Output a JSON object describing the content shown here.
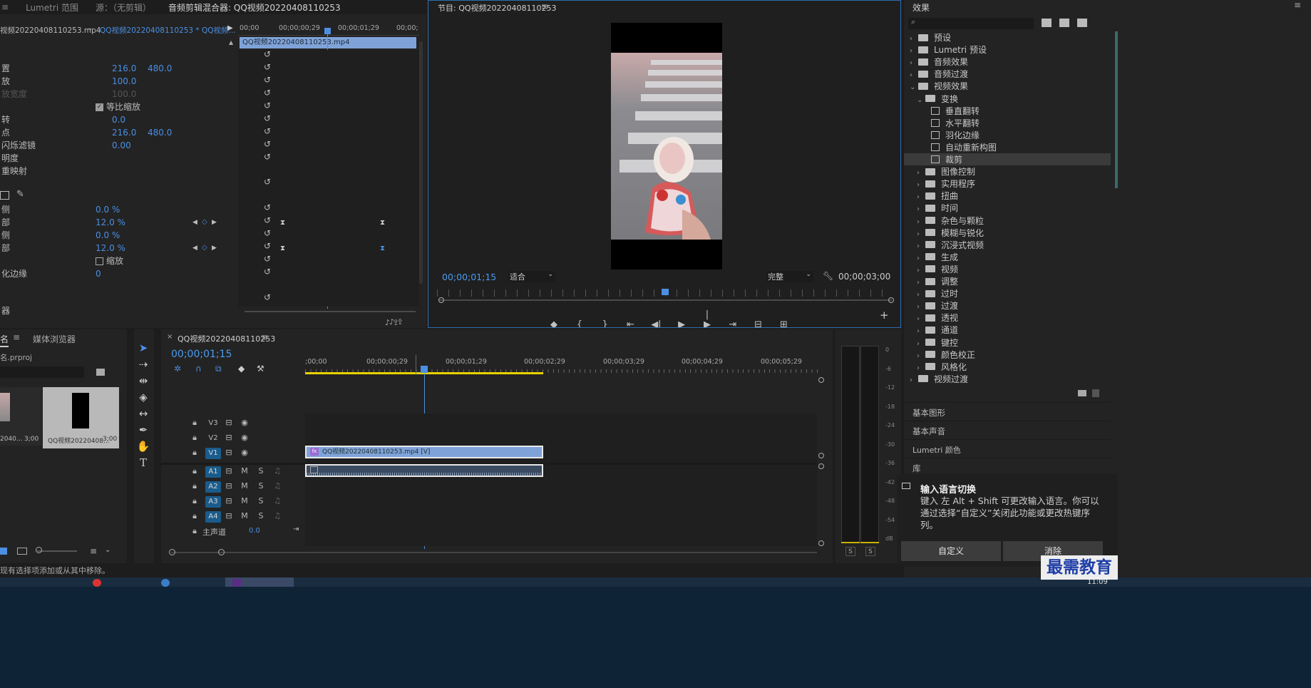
{
  "top_tabs": {
    "tab1": "Lumetri 范围",
    "tab2": "源：（无剪辑）",
    "tab3": "音频剪辑混合器: QQ视频20220408110253",
    "menu": "≡"
  },
  "effect_controls": {
    "clip_source": "视频20220408110253.mp4",
    "clip_seq": "QQ视频20220408110253 * QQ视频...",
    "ruler": [
      "00;00",
      "00;00;00;29",
      "00;00;01;29",
      "00;00;"
    ],
    "clip_bar": "QQ视频20220408110253.mp4",
    "rows": [
      {
        "label": "置",
        "v1": "216.0",
        "v2": "480.0"
      },
      {
        "label": "放",
        "v1": "100.0",
        "v2": ""
      },
      {
        "label": "放宽度",
        "v1": "100.0",
        "v2": ""
      },
      {
        "label": "",
        "v1": "",
        "v2": ""
      },
      {
        "label": "转",
        "v1": "0.0",
        "v2": ""
      },
      {
        "label": "点",
        "v1": "216.0",
        "v2": "480.0"
      },
      {
        "label": "闪烁滤镜",
        "v1": "0.00",
        "v2": ""
      },
      {
        "label": "明度",
        "v1": "",
        "v2": ""
      },
      {
        "label": "重映射",
        "v1": "",
        "v2": ""
      }
    ],
    "uniform_scale": "等比缩放",
    "crop_rows": [
      {
        "label": "侧",
        "v1": "0.0 %"
      },
      {
        "label": "部",
        "v1": "12.0 %"
      },
      {
        "label": "侧",
        "v1": "0.0 %"
      },
      {
        "label": "部",
        "v1": "12.0 %"
      }
    ],
    "zoom_label": "缩放",
    "feather_label": "化边缘",
    "feather_value": "0",
    "bottom_label": "器"
  },
  "program": {
    "title": "节目: QQ视频20220408110253",
    "timecode": "00;00;01;15",
    "fit": "适合",
    "quality": "完整",
    "duration": "00;00;03;00"
  },
  "effects": {
    "title": "效果",
    "search_placeholder": "",
    "items": [
      {
        "label": "预设",
        "level": 0,
        "type": "folder",
        "open": false
      },
      {
        "label": "Lumetri 预设",
        "level": 0,
        "type": "folder",
        "open": false
      },
      {
        "label": "音频效果",
        "level": 0,
        "type": "folder",
        "open": false
      },
      {
        "label": "音频过渡",
        "level": 0,
        "type": "folder",
        "open": false
      },
      {
        "label": "视频效果",
        "level": 0,
        "type": "folder",
        "open": true
      },
      {
        "label": "变换",
        "level": 1,
        "type": "folder",
        "open": true
      },
      {
        "label": "垂直翻转",
        "level": 2,
        "type": "fx"
      },
      {
        "label": "水平翻转",
        "level": 2,
        "type": "fx"
      },
      {
        "label": "羽化边缘",
        "level": 2,
        "type": "fx"
      },
      {
        "label": "自动重新构图",
        "level": 2,
        "type": "fx"
      },
      {
        "label": "裁剪",
        "level": 2,
        "type": "fx",
        "selected": true
      },
      {
        "label": "图像控制",
        "level": 1,
        "type": "folder",
        "open": false
      },
      {
        "label": "实用程序",
        "level": 1,
        "type": "folder",
        "open": false
      },
      {
        "label": "扭曲",
        "level": 1,
        "type": "folder",
        "open": false
      },
      {
        "label": "时间",
        "level": 1,
        "type": "folder",
        "open": false
      },
      {
        "label": "杂色与颗粒",
        "level": 1,
        "type": "folder",
        "open": false
      },
      {
        "label": "模糊与锐化",
        "level": 1,
        "type": "folder",
        "open": false
      },
      {
        "label": "沉浸式视频",
        "level": 1,
        "type": "folder",
        "open": false
      },
      {
        "label": "生成",
        "level": 1,
        "type": "folder",
        "open": false
      },
      {
        "label": "视频",
        "level": 1,
        "type": "folder",
        "open": false
      },
      {
        "label": "调整",
        "level": 1,
        "type": "folder",
        "open": false
      },
      {
        "label": "过时",
        "level": 1,
        "type": "folder",
        "open": false
      },
      {
        "label": "过渡",
        "level": 1,
        "type": "folder",
        "open": false
      },
      {
        "label": "透视",
        "level": 1,
        "type": "folder",
        "open": false
      },
      {
        "label": "通道",
        "level": 1,
        "type": "folder",
        "open": false
      },
      {
        "label": "键控",
        "level": 1,
        "type": "folder",
        "open": false
      },
      {
        "label": "颜色校正",
        "level": 1,
        "type": "folder",
        "open": false
      },
      {
        "label": "风格化",
        "level": 1,
        "type": "folder",
        "open": false
      },
      {
        "label": "视频过渡",
        "level": 0,
        "type": "folder",
        "open": false
      }
    ],
    "sections": [
      "基本图形",
      "基本声音",
      "Lumetri 颜色",
      "库"
    ]
  },
  "project": {
    "tab1": "名",
    "tab2": "媒体浏览器",
    "file": "名.prproj",
    "thumb1_name": "2040...",
    "thumb1_dur": "3;00",
    "thumb2_name": "QQ视频20220408...",
    "thumb2_dur": "3;00"
  },
  "timeline": {
    "title": "QQ视频20220408110253",
    "timecode": "00;00;01;15",
    "ruler": [
      ";00;00",
      "00;00;00;29",
      "00;00;01;29",
      "00;00;02;29",
      "00;00;03;29",
      "00;00;04;29",
      "00;00;05;29"
    ],
    "video_tracks": [
      "V3",
      "V2",
      "V1"
    ],
    "audio_tracks": [
      "A1",
      "A2",
      "A3",
      "A4"
    ],
    "master": "主声道",
    "master_value": "0.0",
    "clip_v": "QQ视频20220408110253.mp4 [V]",
    "m": "M",
    "s": "S"
  },
  "meter": {
    "scale": [
      "0",
      "-6",
      "-12",
      "-18",
      "-24",
      "-30",
      "-36",
      "-42",
      "-48",
      "-54",
      "dB"
    ],
    "s1": "S",
    "s2": "S"
  },
  "ime_popup": {
    "title": "输入语言切换",
    "body": "键入 左 Alt + Shift 可更改输入语言。你可以通过选择“自定义”关闭此功能或更改热键序列。",
    "btn_custom": "自定义",
    "btn_cancel": "消除"
  },
  "status": "现有选择项添加或从其中移除。",
  "watermark": "最需教育",
  "clock": "11:09",
  "colors": {
    "accent": "#4b8fe2",
    "clip_video": "#7fa3d8",
    "track_on": "#1a5c8c",
    "yellow": "#e8d100"
  }
}
